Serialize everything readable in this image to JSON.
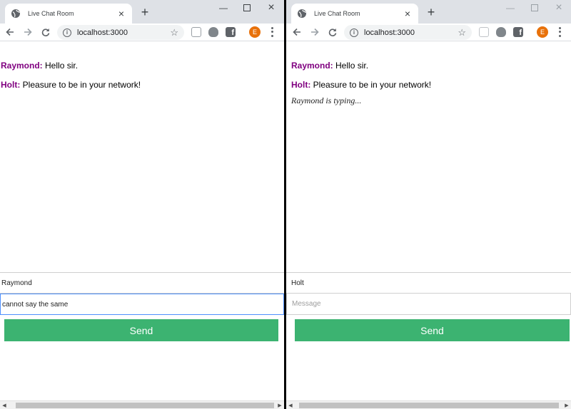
{
  "windows": {
    "left": {
      "tab_title": "Live Chat Room",
      "url": "localhost:3000",
      "avatar_letter": "E",
      "messages": [
        {
          "author": "Raymond:",
          "text": "Hello sir."
        },
        {
          "author": "Holt:",
          "text": "Pleasure to be in your network!"
        }
      ],
      "typing_indicator": "",
      "handle_value": "Raymond",
      "message_value": "cannot say the same",
      "message_placeholder": "Message",
      "send_label": "Send"
    },
    "right": {
      "tab_title": "Live Chat Room",
      "url": "localhost:3000",
      "avatar_letter": "E",
      "messages": [
        {
          "author": "Raymond:",
          "text": "Hello sir."
        },
        {
          "author": "Holt:",
          "text": "Pleasure to be in your network!"
        }
      ],
      "typing_indicator": "Raymond is typing...",
      "handle_value": "Holt",
      "message_value": "",
      "message_placeholder": "Message",
      "send_label": "Send"
    }
  },
  "icons": {
    "tab_favicon": "globe-icon",
    "tab_close": "close-icon",
    "new_tab": "plus-icon",
    "minimize": "minimize-icon",
    "maximize": "maximize-icon",
    "window_close": "close-icon",
    "back": "back-arrow-icon",
    "forward": "forward-arrow-icon",
    "reload": "reload-icon",
    "site_info": "info-icon",
    "bookmark": "star-icon",
    "extension_1": "extension-icon",
    "extension_2": "shield-icon",
    "extension_3": "facebook-icon",
    "menu": "more-vert-icon"
  },
  "colors": {
    "author": "#800080",
    "send_button": "#3cb371",
    "focus_border": "#4d90fe",
    "avatar": "#e8710a"
  }
}
